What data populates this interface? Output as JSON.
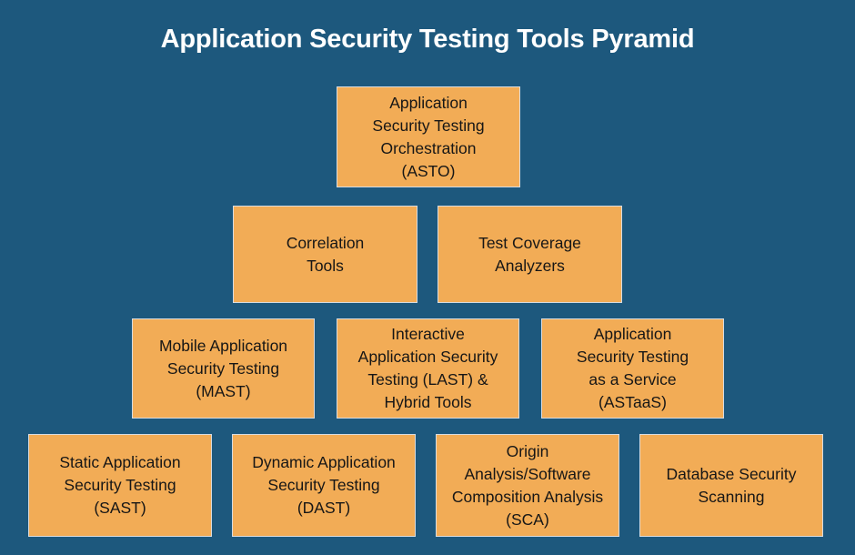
{
  "title": "Application Security Testing Tools Pyramid",
  "colors": {
    "background": "#1d587d",
    "box_fill": "#f2ac56",
    "box_border": "#d8dce0",
    "box_text": "#161616",
    "title_text": "#ffffff"
  },
  "pyramid": {
    "rows": [
      {
        "level": 1,
        "boxes": [
          {
            "label": "Application\nSecurity Testing\nOrchestration\n(ASTO)"
          }
        ]
      },
      {
        "level": 2,
        "boxes": [
          {
            "label": "Correlation\nTools"
          },
          {
            "label": "Test Coverage\nAnalyzers"
          }
        ]
      },
      {
        "level": 3,
        "boxes": [
          {
            "label": "Mobile Application\nSecurity Testing\n(MAST)"
          },
          {
            "label": "Interactive\nApplication Security\nTesting (LAST) &\nHybrid Tools"
          },
          {
            "label": "Application\nSecurity Testing\nas a Service\n(ASTaaS)"
          }
        ]
      },
      {
        "level": 4,
        "boxes": [
          {
            "label": "Static Application\nSecurity Testing\n(SAST)"
          },
          {
            "label": "Dynamic Application\nSecurity Testing\n(DAST)"
          },
          {
            "label": "Origin\nAnalysis/Software\nComposition Analysis\n(SCA)"
          },
          {
            "label": "Database Security\nScanning"
          }
        ]
      }
    ]
  }
}
